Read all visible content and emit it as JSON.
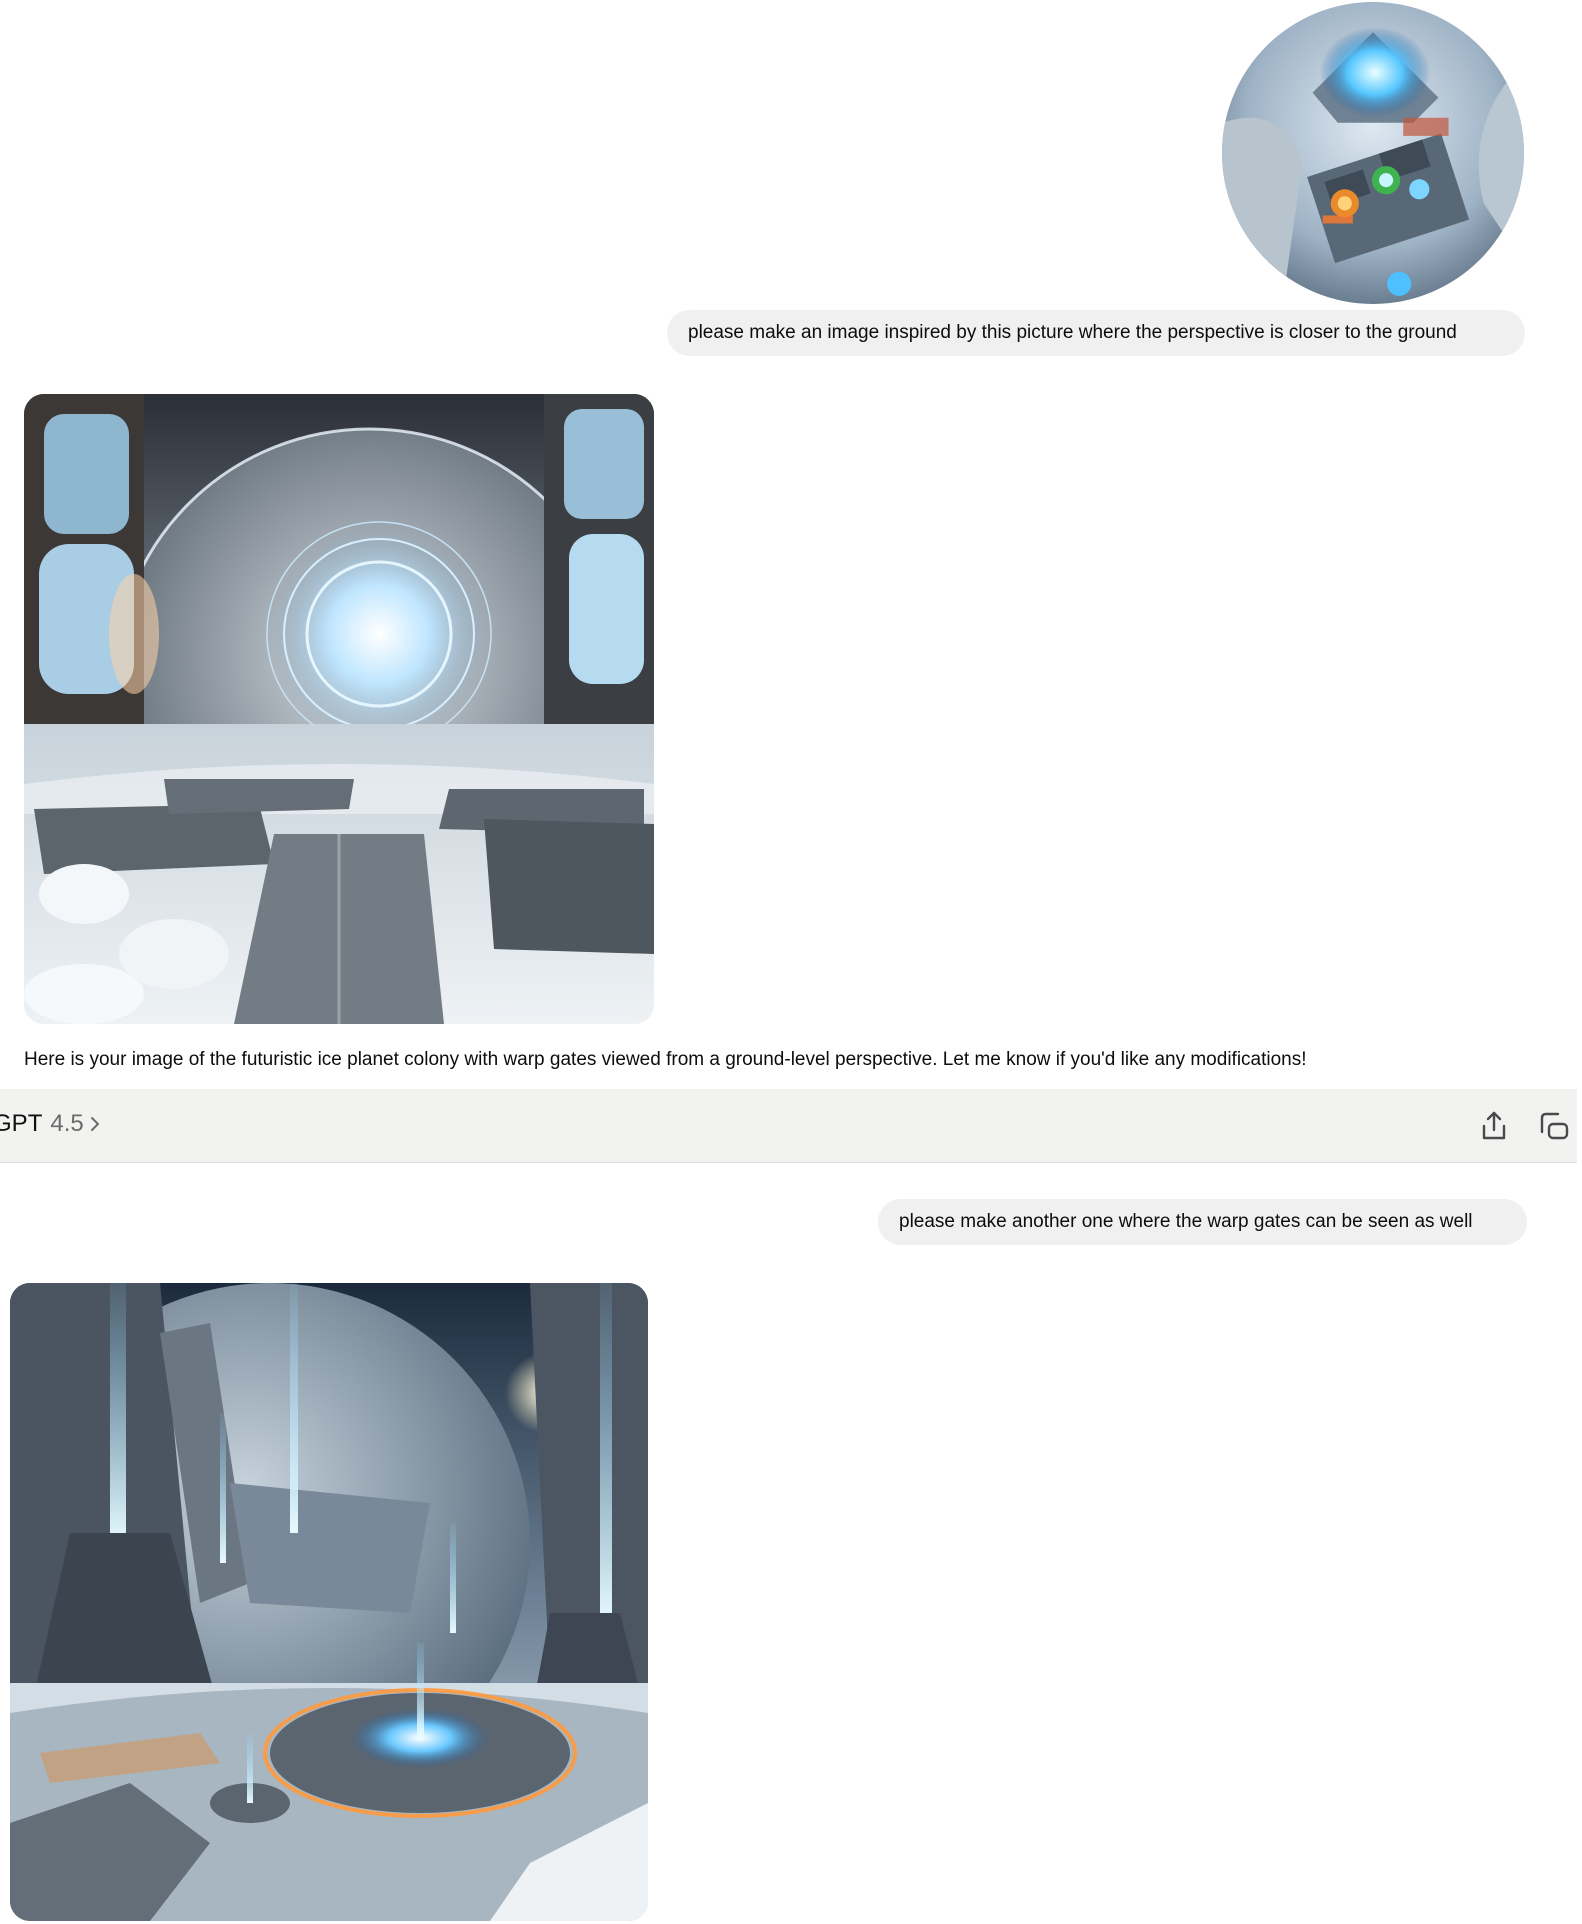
{
  "conversation": {
    "user_attachment": {
      "description_icon": "image-thumbnail"
    },
    "user_message_1": "please make an image inspired by this picture where the perspective is closer to the ground",
    "assistant_message_1": "Here is your image of the futuristic ice planet colony with warp gates viewed from a ground-level perspective. Let me know if you'd like any modifications!",
    "user_message_2": "please make another one where the warp gates can be seen as well"
  },
  "model_bar": {
    "name": "atGPT",
    "version": "4.5",
    "chevron_icon": "chevron-right-icon",
    "share_icon": "share-icon",
    "copy_icon": "copy-icon"
  },
  "colors": {
    "bubble_bg": "#f0f0f0",
    "bar_bg": "#f2f2f1",
    "text": "#0d0d0d",
    "muted": "#6b6b6b"
  }
}
